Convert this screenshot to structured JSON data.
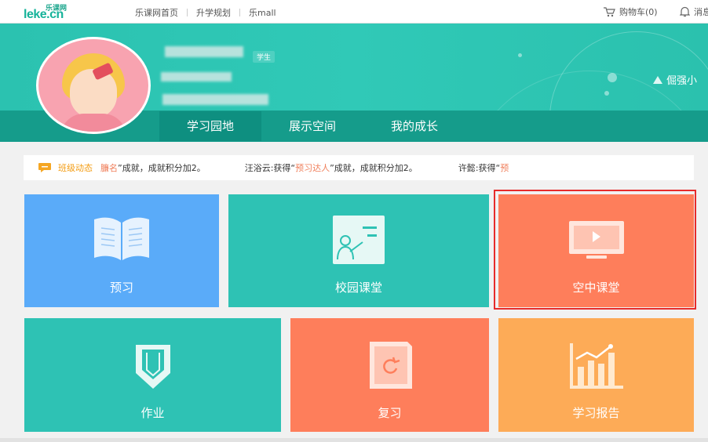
{
  "topbar": {
    "logo_small": "乐课网",
    "logo_main": "leke.cn",
    "nav": [
      "乐课网首页",
      "升学规划",
      "乐mall"
    ],
    "cart_label": "购物车(0)",
    "message_label": "消息"
  },
  "profile": {
    "role_badge": "学生",
    "right_user": "倔强小"
  },
  "tabs": [
    "学习园地",
    "展示空间",
    "我的成长"
  ],
  "news": {
    "label": "班级动态",
    "items": [
      {
        "name": "",
        "pre": "",
        "title": "臁名",
        "suffix": "”成就，成就积分加2。"
      },
      {
        "name": "汪浴云",
        "pre": ":获得“",
        "title": "预习达人",
        "suffix": "”成就，成就积分加2。"
      },
      {
        "name": "许懿",
        "pre": ":获得“",
        "title": "预",
        "suffix": ""
      }
    ]
  },
  "tiles": {
    "preview": "预习",
    "campus_class": "校园课堂",
    "air_class": "空中课堂",
    "homework": "作业",
    "review": "复习",
    "report": "学习报告"
  },
  "colors": {
    "blue": "#5aabf9",
    "teal": "#2ec2b4",
    "orange": "#fe7e5b",
    "amber": "#fdab57",
    "hero": "#2bc2b0",
    "selection": "#e62b2b"
  }
}
